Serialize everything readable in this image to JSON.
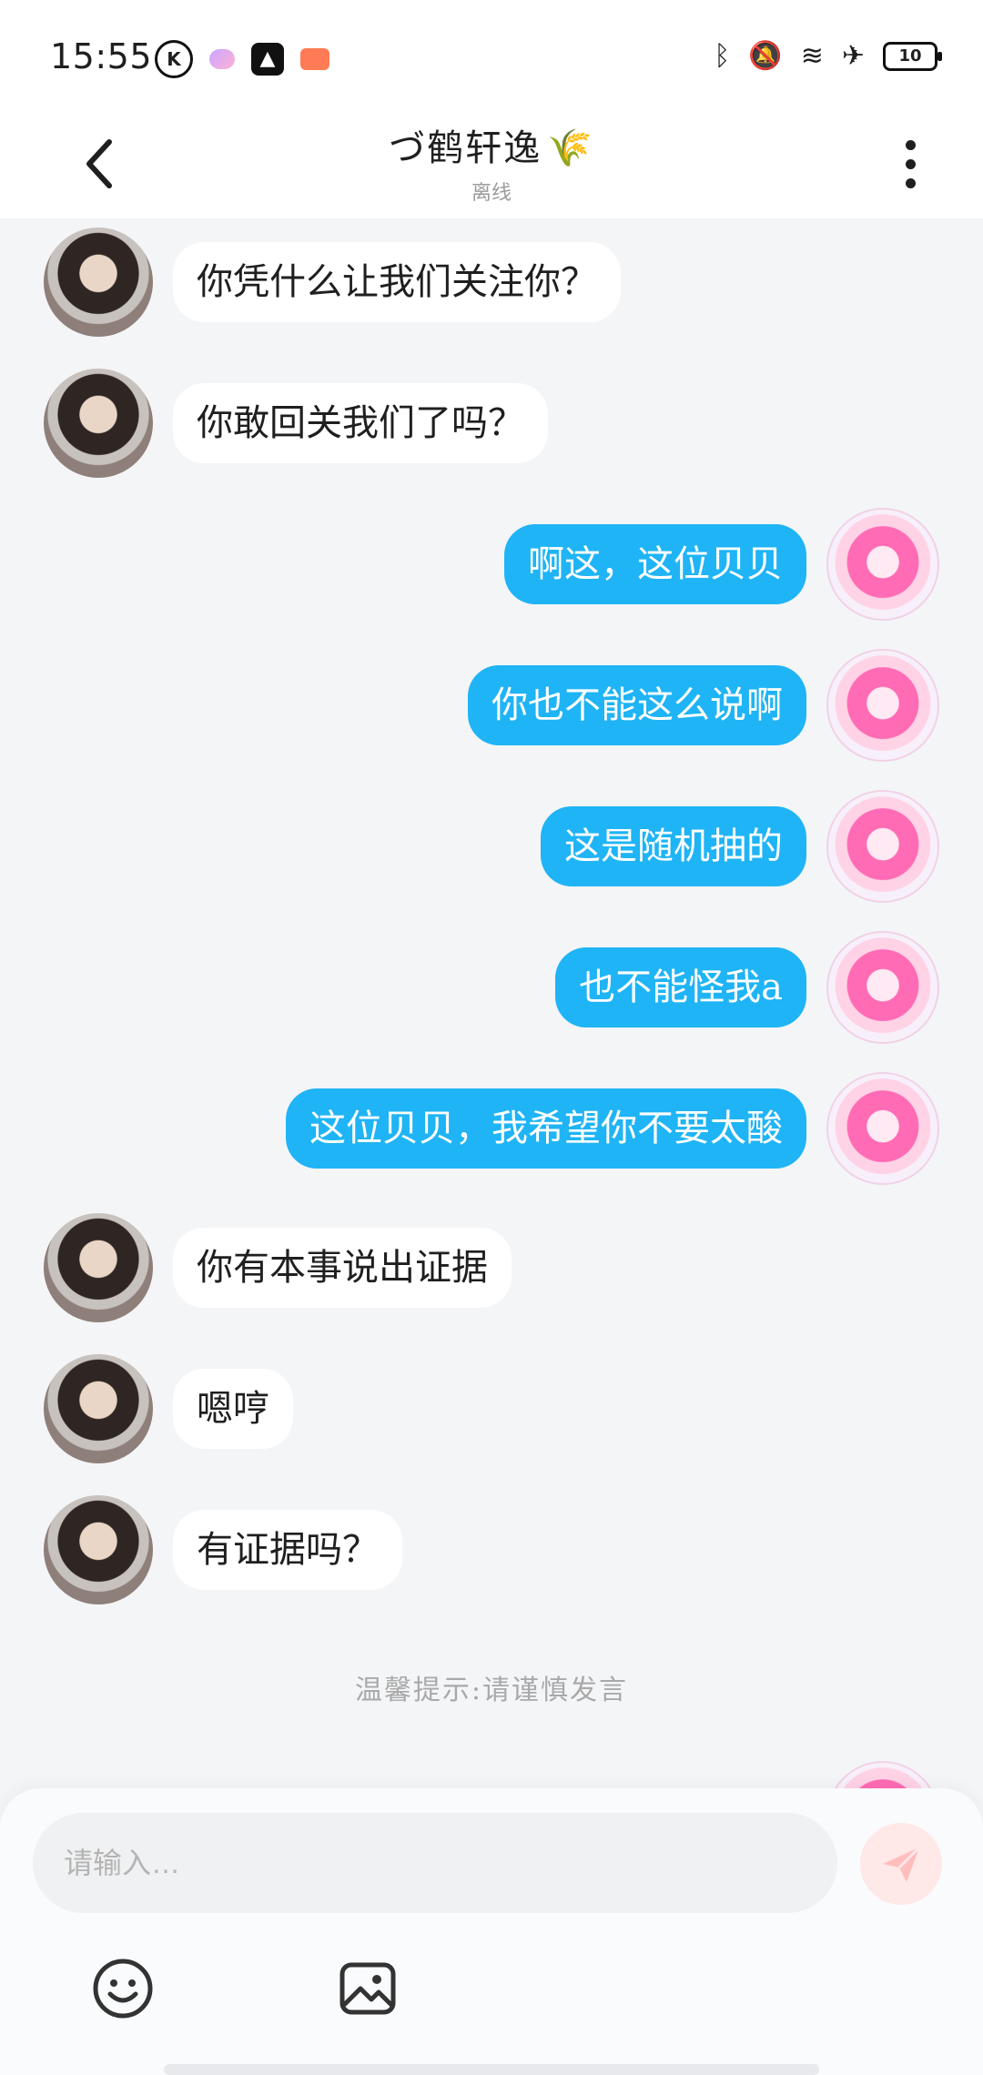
{
  "status_bar": {
    "time": "15:55",
    "battery": "10"
  },
  "header": {
    "title": "づ鹤轩逸",
    "title_icon": "wheat-icon",
    "subtitle": "离线"
  },
  "messages": [
    {
      "side": "in",
      "text": "你凭什么让我们关注你？"
    },
    {
      "side": "in",
      "text": "你敢回关我们了吗？"
    },
    {
      "side": "out",
      "text": "啊这，这位贝贝"
    },
    {
      "side": "out",
      "text": "你也不能这么说啊"
    },
    {
      "side": "out",
      "text": "这是随机抽的"
    },
    {
      "side": "out",
      "text": "也不能怪我a"
    },
    {
      "side": "out",
      "text": "这位贝贝，我希望你不要太酸"
    },
    {
      "side": "in",
      "text": "你有本事说出证据"
    },
    {
      "side": "in",
      "text": "嗯哼"
    },
    {
      "side": "in",
      "text": "有证据吗？"
    }
  ],
  "tip": "温馨提示:请谨慎发言",
  "composer": {
    "placeholder": "请输入…"
  },
  "colors": {
    "outgoing_bubble": "#1fb4f5",
    "incoming_bubble": "#ffffff",
    "background": "#f4f5f7",
    "send_button": "#ffe8e8"
  }
}
